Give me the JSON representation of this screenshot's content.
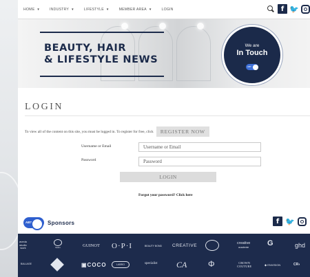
{
  "nav": {
    "items": [
      {
        "label": "HOME",
        "dropdown": true
      },
      {
        "label": "INDUSTRY",
        "dropdown": true
      },
      {
        "label": "LIFESTYLE",
        "dropdown": true
      },
      {
        "label": "MEMBER AREA",
        "dropdown": true
      },
      {
        "label": "LOGIN",
        "dropdown": false
      }
    ],
    "caret": "▼",
    "icons": [
      "search-icon",
      "facebook-icon",
      "twitter-icon",
      "instagram-icon"
    ]
  },
  "banner": {
    "title_line1": "BEAUTY, HAIR",
    "title_line2": "& LIFESTYLE NEWS",
    "badge_line1": "We are",
    "badge_line2": "In Touch",
    "badge_logo": "ABT"
  },
  "login": {
    "heading": "LOGIN",
    "intro": "To view all of the content on this site, you must be logged in. To register for free, click",
    "register_label": "REGISTER NOW",
    "username_label": "Username or Email",
    "username_placeholder": "Username or Email",
    "password_label": "Password",
    "password_placeholder": "Password",
    "submit_label": "LOGIN",
    "forgot": "Forgot your password? Click here"
  },
  "sponsors": {
    "logo": "ABT",
    "label": "Sponsors",
    "row1": [
      "aveda\nstudio\nwork",
      "Guinot",
      "GUINOT",
      "O·P·I",
      "Beauty Bond",
      "CREATIVE",
      "globe",
      "creative\nacademie",
      "G",
      "ghd"
    ],
    "row2": [
      "BALLAGE",
      "Biosculpture",
      "COCO",
      "LABRO",
      "SPECIALIST",
      "CA",
      "Φ",
      "CROWN\nCOUTURE",
      "ENVISION",
      "CR"
    ]
  },
  "colors": {
    "navy": "#1b2a4a",
    "accent": "#2f5fce",
    "footer": "#1d2b4c"
  }
}
